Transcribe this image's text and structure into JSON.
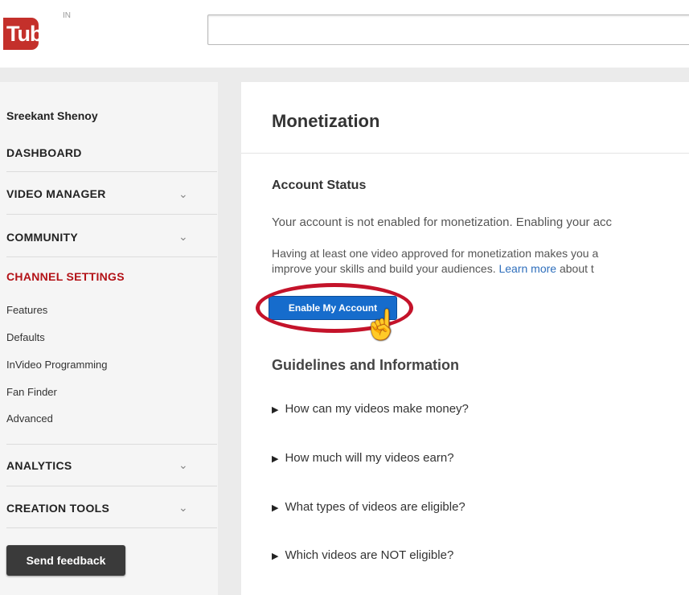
{
  "header": {
    "logo_text": "Tube",
    "logo_region": "IN",
    "search": {
      "value": "",
      "placeholder": ""
    }
  },
  "sidebar": {
    "user_name": "Sreekant Shenoy",
    "dashboard": "DASHBOARD",
    "sections": [
      {
        "label": "VIDEO MANAGER",
        "icon": "chevron-down-icon"
      },
      {
        "label": "COMMUNITY",
        "icon": "chevron-down-icon"
      },
      {
        "label": "CHANNEL SETTINGS",
        "active": true,
        "active_color": "#b31217"
      },
      {
        "label": "ANALYTICS",
        "icon": "chevron-down-icon"
      },
      {
        "label": "CREATION TOOLS",
        "icon": "chevron-down-icon"
      }
    ],
    "channel_settings_items": [
      "Features",
      "Defaults",
      "InVideo Programming",
      "Fan Finder",
      "Advanced"
    ],
    "feedback_label": "Send feedback"
  },
  "main": {
    "title": "Monetization",
    "account_status_heading": "Account Status",
    "para1": "Your account is not enabled for monetization. Enabling your acc",
    "para2_line1": "Having at least one video approved for monetization makes you a",
    "para2_line2_pre": "improve your skills and build your audiences. ",
    "para2_link": "Learn more",
    "para2_line2_post": " about t",
    "enable_button": "Enable My Account",
    "guidelines_heading": "Guidelines and Information",
    "faqs": [
      "How can my videos make money?",
      "How much will my videos earn?",
      "What types of videos are eligible?",
      "Which videos are NOT eligible?"
    ]
  },
  "colors": {
    "brand_red": "#c4302b",
    "button_blue": "#166ccc",
    "highlight_red": "#c4132a",
    "link_blue": "#2f6fbc"
  }
}
